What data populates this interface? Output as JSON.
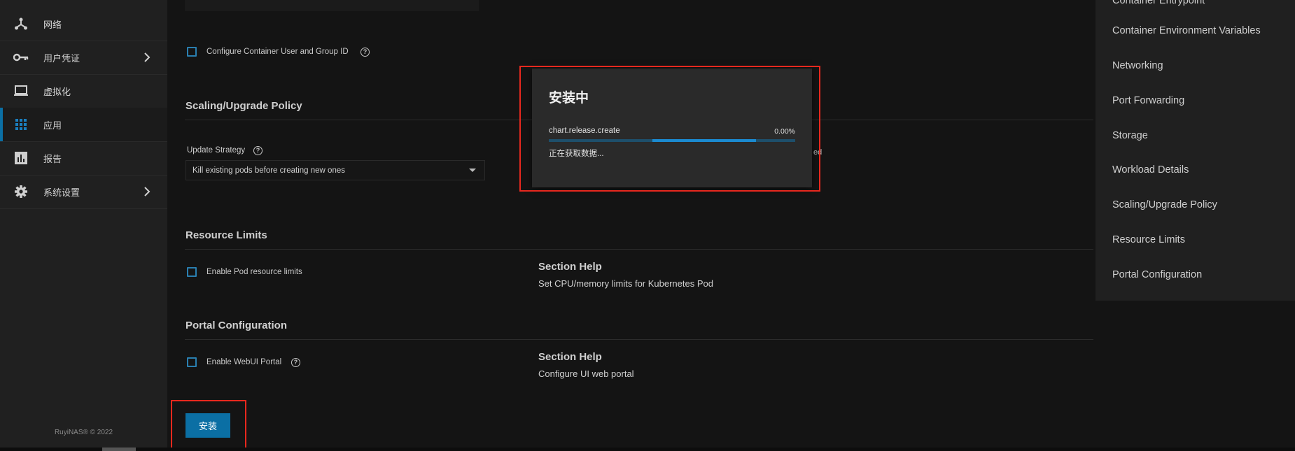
{
  "sidebar": {
    "items": [
      {
        "label": "网络",
        "icon": "network-icon"
      },
      {
        "label": "用户凭证",
        "icon": "key-icon",
        "has_submenu": true
      },
      {
        "label": "虚拟化",
        "icon": "monitor-icon"
      },
      {
        "label": "应用",
        "icon": "apps-grid-icon",
        "active": true
      },
      {
        "label": "报告",
        "icon": "bar-chart-icon"
      },
      {
        "label": "系统设置",
        "icon": "gear-icon",
        "has_submenu": true
      }
    ],
    "copyright": "RuyiNAS® © 2022"
  },
  "main": {
    "truncated_top_text": "",
    "container_user": {
      "label": "Configure Container User and Group ID",
      "checked": false
    },
    "scaling_section": {
      "title": "Scaling/Upgrade Policy",
      "update_strategy_label": "Update Strategy",
      "update_strategy_value": "Kill existing pods before creating new ones",
      "obscured_text": "ed"
    },
    "resource_section": {
      "title": "Resource Limits",
      "checkbox_label": "Enable Pod resource limits",
      "checked": false,
      "help_title": "Section Help",
      "help_text": "Set CPU/memory limits for Kubernetes Pod"
    },
    "portal_section": {
      "title": "Portal Configuration",
      "checkbox_label": "Enable WebUI Portal",
      "checked": false,
      "help_title": "Section Help",
      "help_text": "Configure UI web portal"
    },
    "install_button": "安装"
  },
  "toc": {
    "items": [
      "Container Entrypoint",
      "Container Environment Variables",
      "Networking",
      "Port Forwarding",
      "Storage",
      "Workload Details",
      "Scaling/Upgrade Policy",
      "Resource Limits",
      "Portal Configuration"
    ]
  },
  "dialog": {
    "title": "安装中",
    "job_name": "chart.release.create",
    "percent_text": "0.00%",
    "status_text": "正在获取数据...",
    "progress_fraction": 0.0
  },
  "colors": {
    "accent": "#0b6fa4",
    "highlight": "#e8281e",
    "background": "#141414",
    "panel": "#202020"
  }
}
